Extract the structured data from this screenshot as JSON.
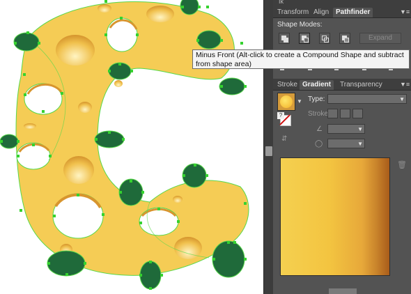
{
  "top_panel": {
    "partial_tab": "Ik",
    "tabs": [
      "Transform",
      "Align",
      "Pathfinder"
    ],
    "active_tab": "Pathfinder",
    "shape_modes_label": "Shape Modes:",
    "expand_label": "Expand"
  },
  "tooltip": {
    "text": "Minus Front (Alt-click to create a Compound Shape and subtract from shape area)"
  },
  "gradient_panel": {
    "tabs": [
      "Stroke",
      "Gradient",
      "Transparency"
    ],
    "active_tab": "Gradient",
    "type_label": "Type:",
    "stroke_label": "Stroke:",
    "gradient_colors": [
      "#f5d050",
      "#f3c440",
      "#e7a83a",
      "#c9842b",
      "#a95c1a"
    ]
  },
  "icons": [
    "panel-menu-icon",
    "unite-icon",
    "minus-front-icon",
    "intersect-icon",
    "exclude-icon",
    "trash-icon",
    "angle-icon",
    "aspect-ratio-icon",
    "reverse-gradient-icon"
  ],
  "colors": {
    "cheese_fill": "#f5cc55",
    "hole_shadow": "#e2a83a",
    "leaf_fill": "#1f6a3a",
    "anchor_point": "#35d22f",
    "panel_bg": "#535353"
  }
}
